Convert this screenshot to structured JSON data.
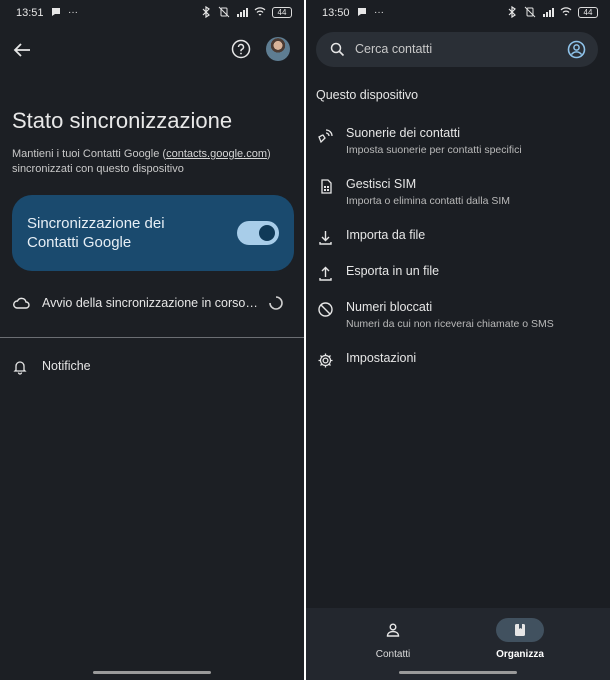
{
  "left_screen": {
    "status": {
      "time": "13:51",
      "battery": "44"
    },
    "title": "Stato sincronizzazione",
    "description_pre": "Mantieni i tuoi Contatti Google (",
    "description_link": "contacts.google.com",
    "description_post": ") sincronizzati con questo dispositivo",
    "sync_card_label": "Sincronizzazione dei Contatti Google",
    "sync_toggle_on": true,
    "sync_status": "Avvio della sincronizzazione in corso…",
    "notifications_label": "Notifiche",
    "icons": [
      "back-arrow-icon",
      "help-icon",
      "avatar",
      "cloud-icon",
      "spinner-icon",
      "bell-icon"
    ]
  },
  "right_screen": {
    "status": {
      "time": "13:50",
      "battery": "44"
    },
    "search_placeholder": "Cerca contatti",
    "section_title": "Questo dispositivo",
    "menu": [
      {
        "title": "Suonerie dei contatti",
        "subtitle": "Imposta suonerie per contatti specifici",
        "icon": "ringtone-icon"
      },
      {
        "title": "Gestisci SIM",
        "subtitle": "Importa o elimina contatti dalla SIM",
        "icon": "sim-card-icon"
      },
      {
        "title": "Importa da file",
        "subtitle": "",
        "icon": "download-icon"
      },
      {
        "title": "Esporta in un file",
        "subtitle": "",
        "icon": "upload-icon"
      },
      {
        "title": "Numeri bloccati",
        "subtitle": "Numeri da cui non riceverai chiamate o SMS",
        "icon": "block-icon"
      },
      {
        "title": "Impostazioni",
        "subtitle": "",
        "icon": "settings-gear-icon"
      }
    ],
    "bottom_nav": [
      {
        "label": "Contatti",
        "icon": "person-icon",
        "active": false
      },
      {
        "label": "Organizza",
        "icon": "bookmark-book-icon",
        "active": true
      }
    ]
  },
  "colors": {
    "background": "#1c1f24",
    "sync_card": "#1a4a6e",
    "toggle_track": "#a8cde9",
    "active_pill": "#41515f"
  }
}
